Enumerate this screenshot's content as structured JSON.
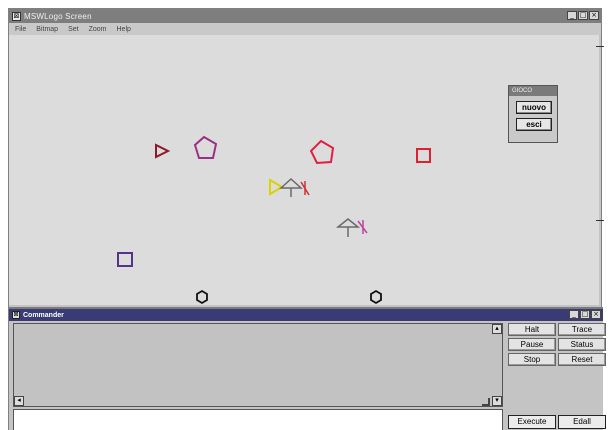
{
  "main_window": {
    "title": "MSWLogo Screen",
    "menu": [
      "File",
      "Bitmap",
      "Set",
      "Zoom",
      "Help"
    ],
    "controls": {
      "minimize": "_",
      "maximize": "□",
      "close": "×"
    }
  },
  "palette": {
    "title": "GIOCO",
    "buttons": [
      "nuovo",
      "esci"
    ]
  },
  "canvas": {
    "shapes": [
      {
        "type": "triangle",
        "color": "#8b1a2b"
      },
      {
        "type": "pentagon",
        "color": "#9a2f86"
      },
      {
        "type": "pentagon",
        "color": "#e02040"
      },
      {
        "type": "square",
        "color": "#e02030"
      },
      {
        "type": "triangle",
        "color": "#d9d300"
      },
      {
        "type": "turtle",
        "color": "#6a6a6a"
      },
      {
        "type": "turtle",
        "color": "#6a6a6a"
      },
      {
        "type": "square",
        "color": "#553388"
      },
      {
        "type": "hexagon",
        "color": "#111111"
      },
      {
        "type": "hexagon",
        "color": "#111111"
      }
    ]
  },
  "commander": {
    "title": "Commander",
    "controls": {
      "minimize": "_",
      "maximize": "□",
      "close": "×"
    },
    "buttons": {
      "halt": "Halt",
      "trace": "Trace",
      "pause": "Pause",
      "status": "Status",
      "stop": "Stop",
      "reset": "Reset",
      "execute": "Execute",
      "edall": "Edall"
    }
  }
}
